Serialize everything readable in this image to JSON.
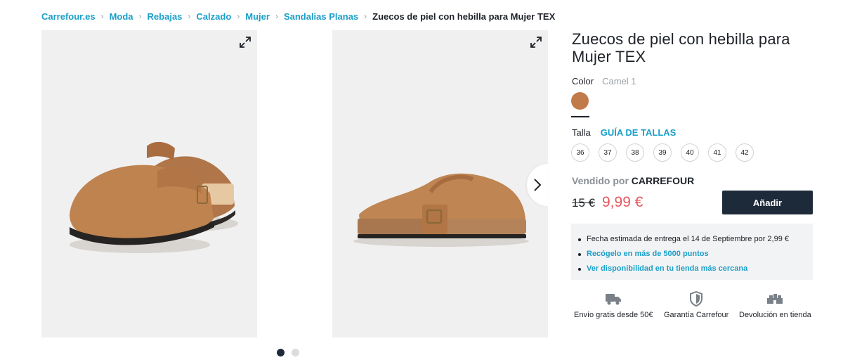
{
  "breadcrumb": {
    "items": [
      "Carrefour.es",
      "Moda",
      "Rebajas",
      "Calzado",
      "Mujer",
      "Sandalias Planas"
    ],
    "current": "Zuecos de piel con hebilla para Mujer TEX"
  },
  "gallery": {
    "active_dot": 1,
    "dot_count": 2
  },
  "product": {
    "title": "Zuecos de piel con hebilla para Mujer TEX",
    "color_label": "Color",
    "color_value": "Camel 1",
    "swatch_color": "#c17a49",
    "size_label": "Talla",
    "size_guide": "GUÍA DE TALLAS",
    "sizes": [
      "36",
      "37",
      "38",
      "39",
      "40",
      "41",
      "42"
    ],
    "sold_by_label": "Vendido por",
    "seller": "CARREFOUR",
    "price_old": "15 €",
    "price_new": "9,99 €",
    "add_button": "Añadir"
  },
  "info": {
    "delivery": "Fecha estimada de entrega el 14 de Septiembre por 2,99 €",
    "pickup": "Recógelo en más de 5000 puntos",
    "availability": "Ver disponibilidad en tu tienda más cercana"
  },
  "features": {
    "shipping": "Envío gratis desde 50€",
    "warranty": "Garantía Carrefour",
    "returns": "Devolución en tienda"
  },
  "colors": {
    "accent": "#1a9fc9",
    "price_red": "#e8565c",
    "button_dark": "#1d2a3a"
  },
  "icons": [
    "expand-icon",
    "chevron-right-icon",
    "truck-icon",
    "shield-icon",
    "store-icon"
  ]
}
